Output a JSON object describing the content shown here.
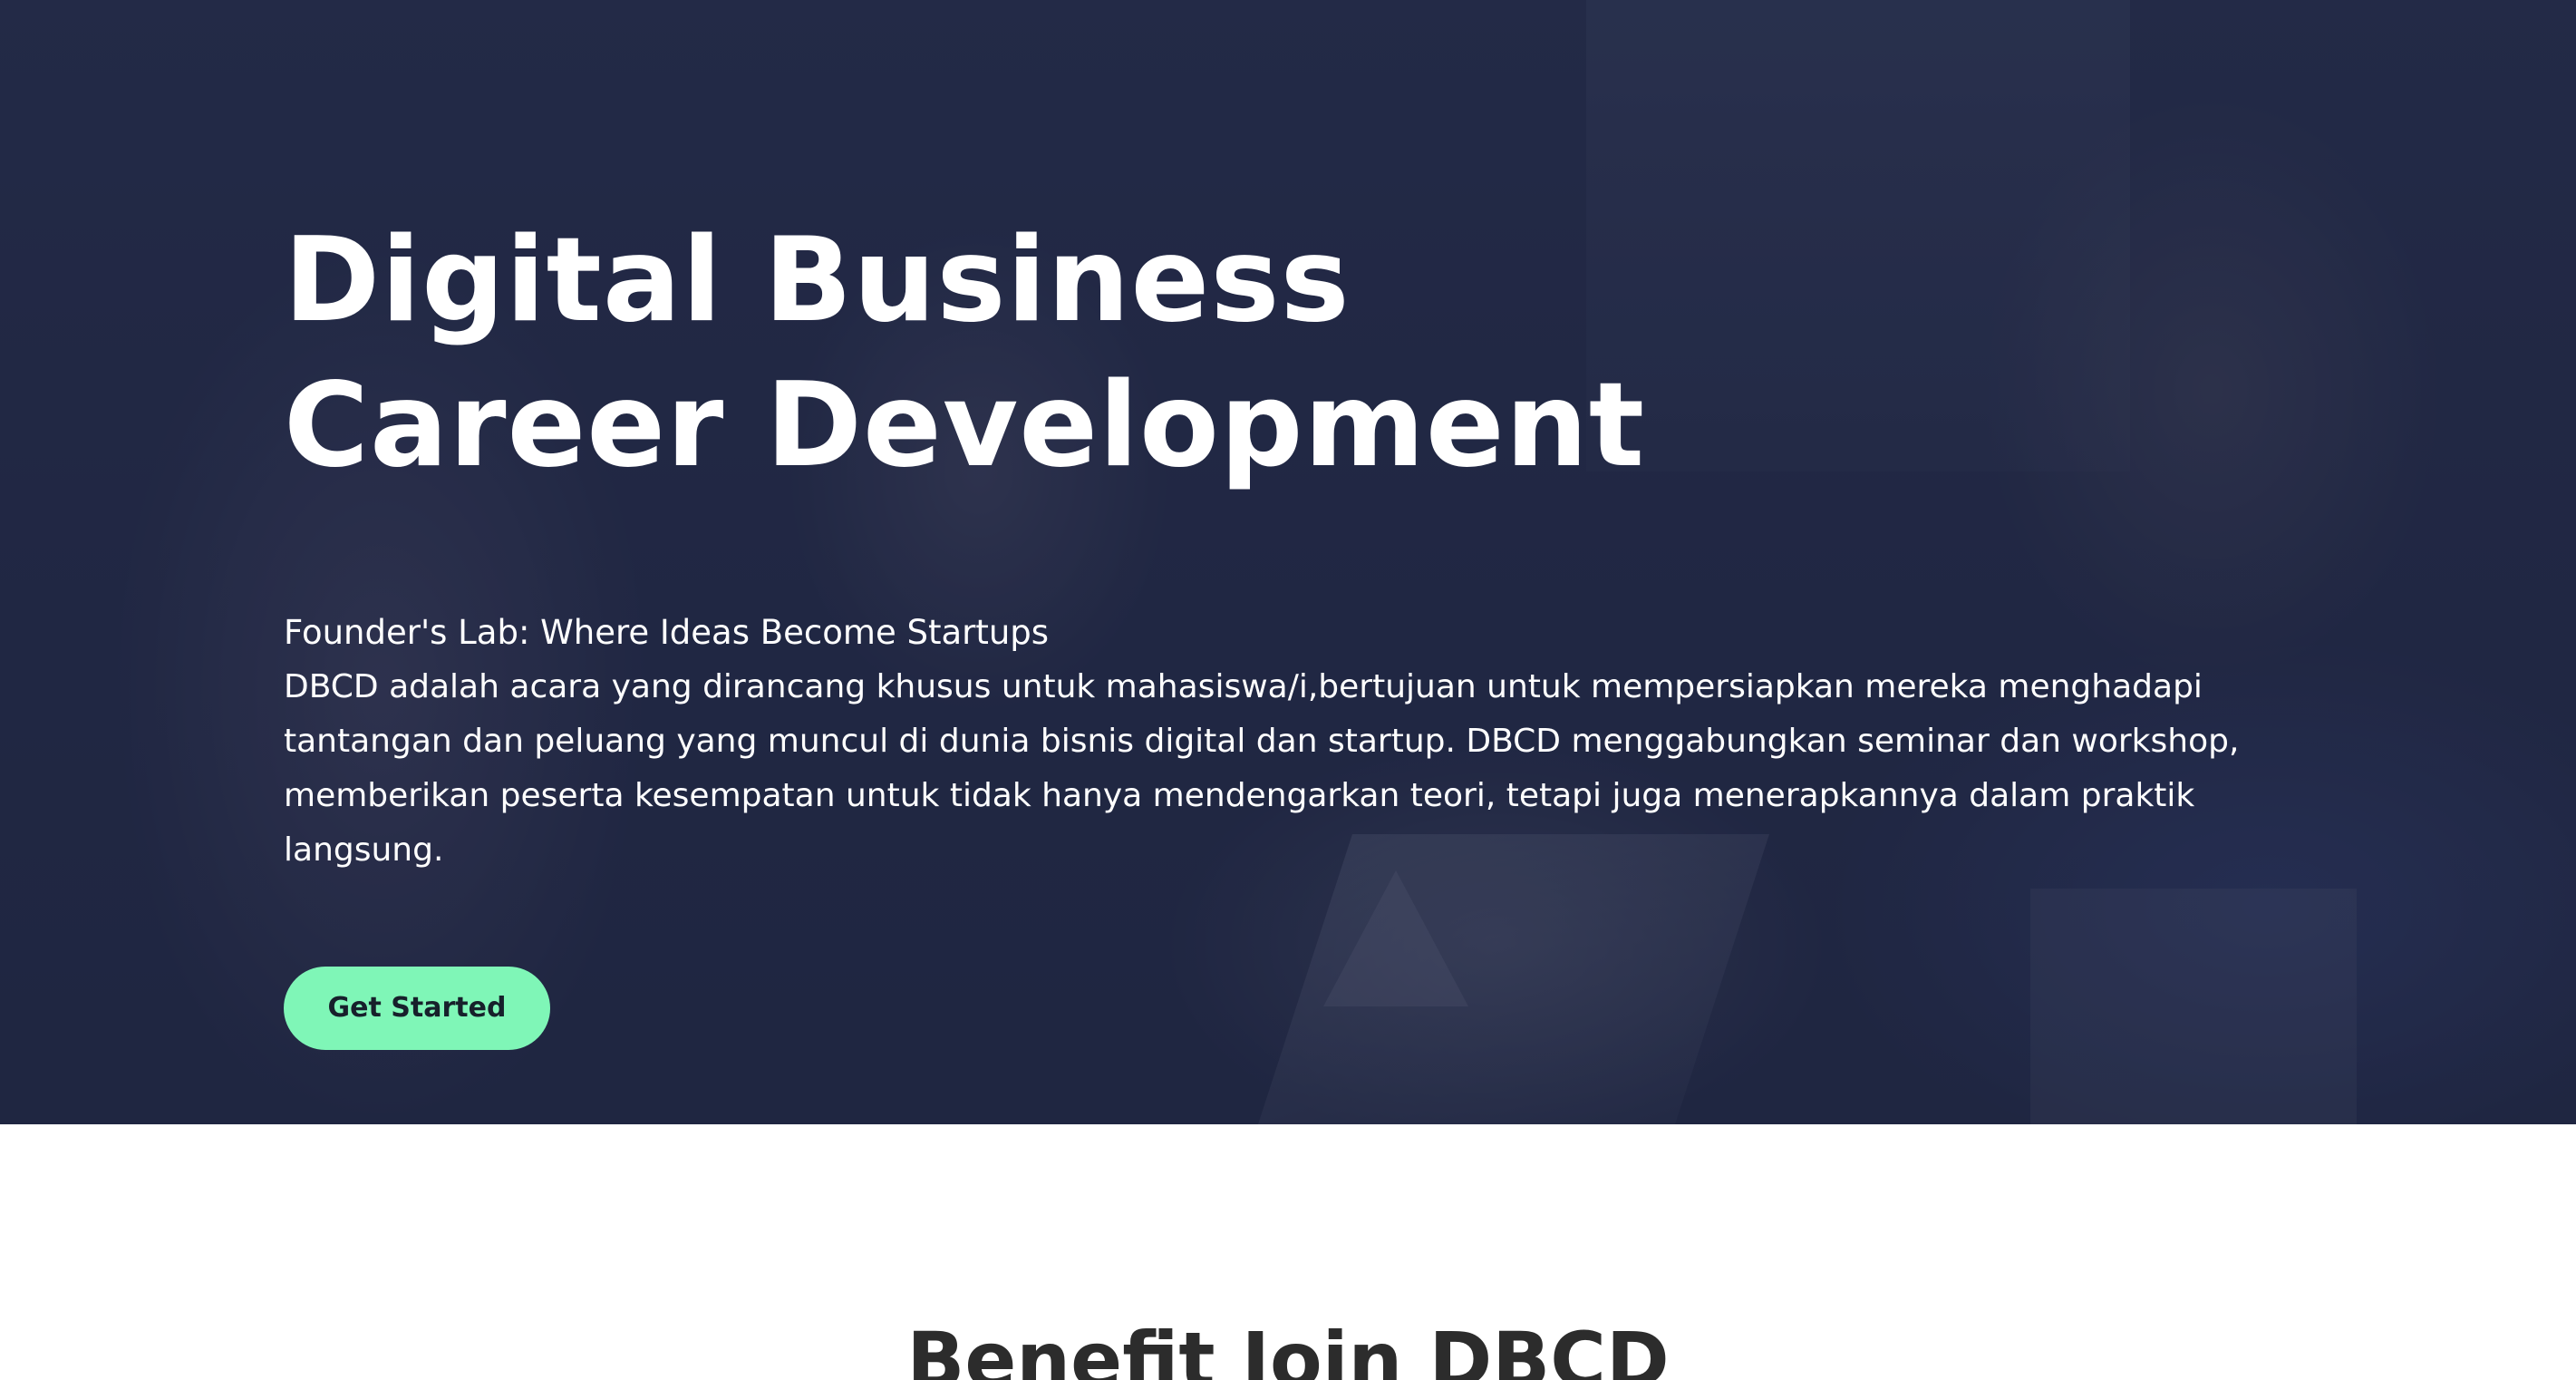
{
  "hero": {
    "title_line1": "Digital Business",
    "title_line2": "Career Development",
    "subtitle": "Founder's Lab: Where Ideas Become Startups",
    "description": "DBCD adalah acara yang dirancang khusus untuk mahasiswa/i,bertujuan untuk mempersiapkan mereka menghadapi tantangan dan peluang yang muncul di dunia bisnis digital dan startup. DBCD menggabungkan seminar dan workshop, memberikan peserta kesempatan untuk tidak hanya mendengarkan teori, tetapi juga menerapkannya dalam praktik langsung.",
    "cta_label": "Get Started",
    "background": "photo of students working together on laptops with dark navy overlay"
  },
  "benefit": {
    "title": "Benefit Join DBCD"
  },
  "colors": {
    "overlay": "#242a46",
    "cta_background": "#7ff6b7",
    "cta_text": "#17202b",
    "hero_text": "#ffffff",
    "section_heading": "#2c2c2c"
  }
}
